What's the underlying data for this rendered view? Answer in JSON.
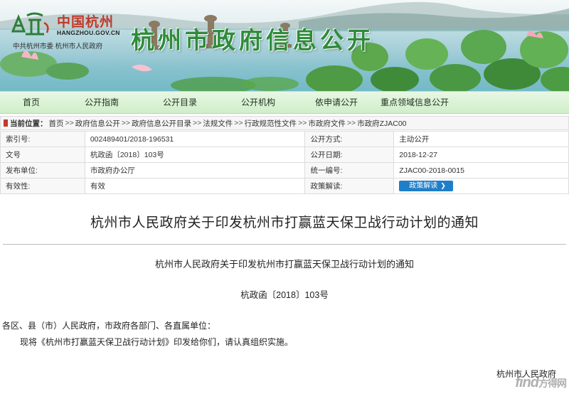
{
  "banner": {
    "logo_cn": "中国杭州",
    "logo_en": "HANGZHOU.GOV.CN",
    "logo_sub": "中共杭州市委  杭州市人民政府",
    "site_title": "杭州市政府信息公开"
  },
  "nav": {
    "items": [
      "首页",
      "公开指南",
      "公开目录",
      "公开机构",
      "依申请公开",
      "重点领域信息公开"
    ]
  },
  "breadcrumb": {
    "label": "当前位置：",
    "items": [
      "首页",
      "政府信息公开",
      "政府信息公开目录",
      "法规文件",
      "行政规范性文件",
      "市政府文件",
      "市政府ZJAC00"
    ],
    "separator": ">>"
  },
  "info": {
    "rows": [
      {
        "k1": "索引号:",
        "v1": "002489401/2018-196531",
        "k2": "公开方式:",
        "v2": "主动公开"
      },
      {
        "k1": "文号",
        "v1": "杭政函〔2018〕103号",
        "k2": "公开日期:",
        "v2": "2018-12-27"
      },
      {
        "k1": "发布单位:",
        "v1": "市政府办公厅",
        "k2": "统一编号:",
        "v2": "ZJAC00-2018-0015"
      },
      {
        "k1": "有效性:",
        "v1": "有效",
        "k2": "政策解读:",
        "v2": ""
      }
    ],
    "policy_button": "政策解读"
  },
  "document": {
    "title": "杭州市人民政府关于印发杭州市打赢蓝天保卫战行动计划的通知",
    "subtitle": "杭州市人民政府关于印发杭州市打赢蓝天保卫战行动计划的通知",
    "number": "杭政函〔2018〕103号",
    "salutation": "各区、县（市）人民政府，市政府各部门、各直属单位：",
    "paragraph": "现将《杭州市打赢蓝天保卫战行动计划》印发给你们，请认真组织实施。",
    "signature": "杭州市人民政府"
  },
  "watermark": {
    "text": "find",
    "suffix": "方得网"
  },
  "colors": {
    "title_green": "#2e8b3a",
    "logo_red": "#c0392b",
    "nav_bg": "#d8f1d1",
    "button_blue": "#1e7ec8"
  }
}
